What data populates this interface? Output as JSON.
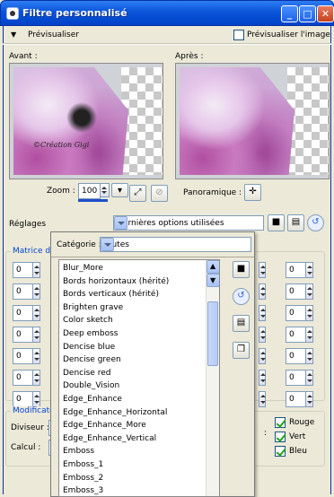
{
  "window": {
    "title": "Filtre personnalisé"
  },
  "toolbar": {
    "preview_label": "Prévisualiser",
    "preview_image_label": "Prévisualiser l'image"
  },
  "previews": {
    "before_label": "Avant :",
    "after_label": "Après :",
    "watermark": "©Création Gigi"
  },
  "zoom": {
    "label": "Zoom :",
    "value": "100",
    "pan_label": "Panoramique :"
  },
  "settings": {
    "label": "Réglages",
    "value": "Dernières options utilisées"
  },
  "matrix": {
    "group_label": "Matrice du",
    "left_values": [
      "0",
      "0",
      "0",
      "0",
      "0",
      "0",
      "0"
    ],
    "right_values": [
      "0",
      "0",
      "0",
      "0",
      "0",
      "0",
      "0"
    ]
  },
  "modifiers": {
    "group_label": "Modificateur",
    "divisor_label": "Diviseur :",
    "calc_label": "Calcul :"
  },
  "channels": {
    "red": "Rouge",
    "green": "Vert",
    "blue": "Bleu"
  },
  "popup": {
    "category_label": "Catégorie :",
    "category_value": "Toutes",
    "items": [
      "Blur_More",
      "Bords horizontaux (hérité)",
      "Bords verticaux (hérité)",
      "Brighten grave",
      "Color sketch",
      "Deep emboss",
      "Dencise blue",
      "Dencise green",
      "Dencise red",
      "Double_Vision",
      "Edge_Enhance",
      "Edge_Enhance_Horizontal",
      "Edge_Enhance_More",
      "Edge_Enhance_Vertical",
      "Emboss",
      "Emboss_1",
      "Emboss_2",
      "Emboss_3"
    ]
  },
  "colors": {
    "titlebar": "#0a55d9",
    "accent": "#0046d5"
  }
}
